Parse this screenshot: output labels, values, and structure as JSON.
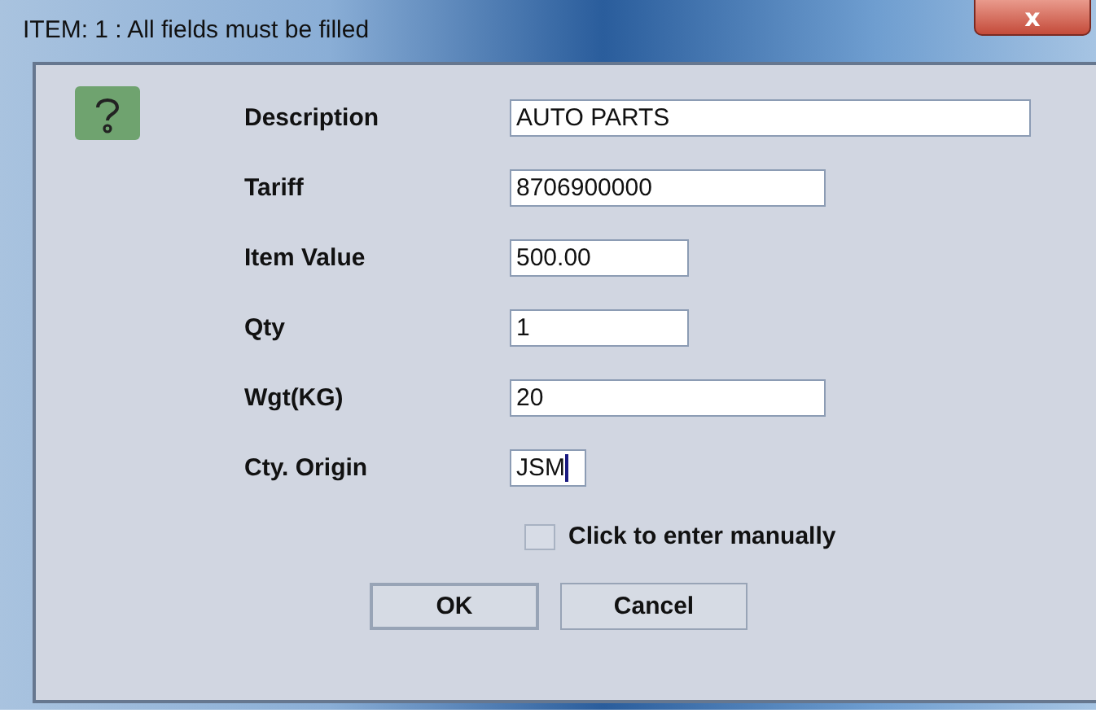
{
  "window": {
    "title": "ITEM: 1 : All fields must be filled",
    "close": "x"
  },
  "fields": [
    {
      "label": "Description",
      "value": "AUTO PARTS",
      "focused": false
    },
    {
      "label": "Tariff",
      "value": "8706900000",
      "focused": false
    },
    {
      "label": "Item Value",
      "value": "500.00",
      "focused": false
    },
    {
      "label": "Qty",
      "value": "1",
      "focused": false
    },
    {
      "label": "Wgt(KG)",
      "value": "20",
      "focused": false
    },
    {
      "label": "Cty. Origin",
      "value": "JSM",
      "focused": true
    }
  ],
  "manual": {
    "label": "Click to enter manually",
    "checked": false
  },
  "buttons": [
    "OK",
    "Cancel"
  ]
}
